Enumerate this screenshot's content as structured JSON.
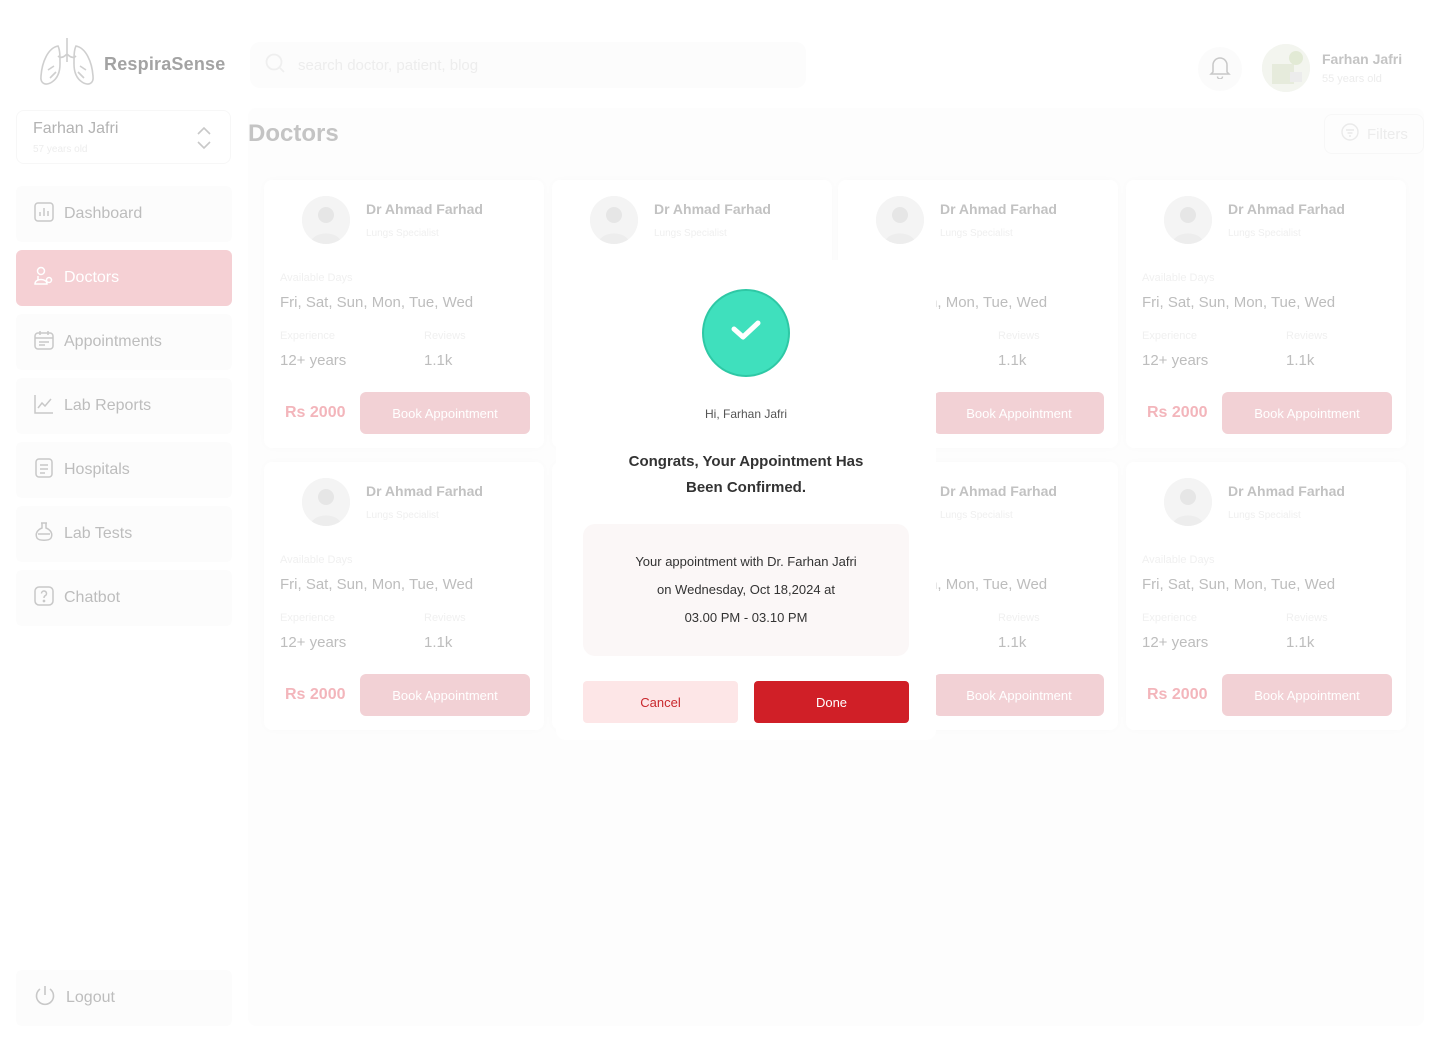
{
  "app": {
    "name": "RespiraSense"
  },
  "search": {
    "placeholder": "search doctor, patient, blog"
  },
  "profile": {
    "name": "Farhan Jafri",
    "age": "55 years old"
  },
  "patient_switch": {
    "name": "Farhan Jafri",
    "age": "57 years old"
  },
  "sidebar": {
    "items": [
      {
        "label": "Dashboard",
        "icon": "chart-icon"
      },
      {
        "label": "Doctors",
        "icon": "doctor-icon",
        "active": true
      },
      {
        "label": "Appointments",
        "icon": "calendar-icon"
      },
      {
        "label": "Lab Reports",
        "icon": "line-chart-icon"
      },
      {
        "label": "Hospitals",
        "icon": "document-icon"
      },
      {
        "label": "Lab Tests",
        "icon": "flask-icon"
      },
      {
        "label": "Chatbot",
        "icon": "help-icon"
      }
    ],
    "logout": "Logout"
  },
  "page": {
    "title": "Doctors",
    "filters": "Filters"
  },
  "doctor_card": {
    "name": "Dr Ahmad Farhad",
    "specialty": "Lungs Specialist",
    "available_label": "Available Days",
    "available_days": "Fri, Sat, Sun, Mon, Tue, Wed",
    "experience_label": "Experience",
    "experience": "12+ years",
    "reviews_label": "Reviews",
    "reviews": "1.1k",
    "price": "Rs 2000",
    "book_label": "Book Appointment"
  },
  "modal": {
    "greeting": "Hi, Farhan Jafri",
    "title": "Congrats, Your Appointment Has Been Confirmed.",
    "detail_line1": "Your appointment with Dr. Farhan Jafri",
    "detail_line2": "on Wednesday, Oct 18,2024 at",
    "detail_line3": "03.00 PM - 03.10 PM",
    "cancel": "Cancel",
    "done": "Done"
  },
  "colors": {
    "accent": "#d01f27",
    "accent_light": "#fde6e7",
    "success": "#3fe0bd",
    "nav_active": "#f5d0d4"
  }
}
